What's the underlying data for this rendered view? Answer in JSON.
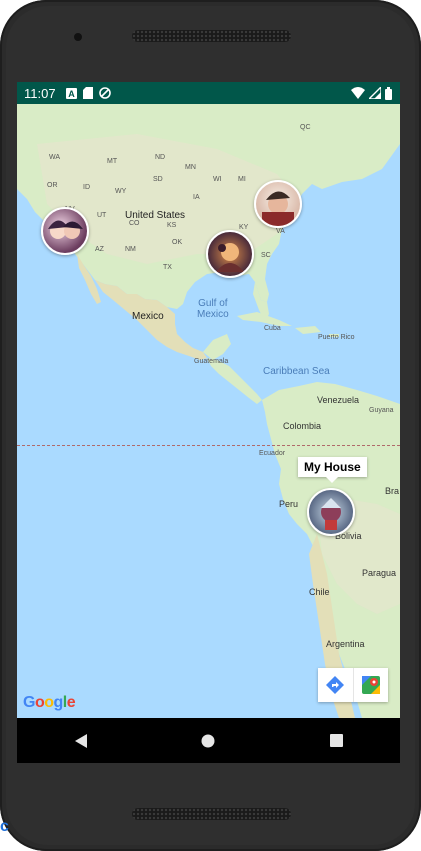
{
  "status_bar": {
    "time": "11:07",
    "icons": [
      "a-notification-icon",
      "sd-card-icon",
      "sync-icon"
    ],
    "right_icons": [
      "wifi-icon",
      "signal-icon",
      "battery-icon"
    ],
    "background": "#01574a"
  },
  "map": {
    "labels": {
      "wa": "WA",
      "mt": "MT",
      "nd": "ND",
      "mn": "MN",
      "or": "OR",
      "id": "ID",
      "sd": "SD",
      "wy": "WY",
      "wi": "WI",
      "mi": "MI",
      "nv": "NV",
      "ut": "UT",
      "co": "CO",
      "ks": "KS",
      "ia": "IA",
      "ca": "CA",
      "az": "AZ",
      "nm": "NM",
      "ok": "OK",
      "tx": "TX",
      "ky": "KY",
      "tn": "TN",
      "sc": "SC",
      "va": "VA",
      "qc": "QC",
      "united_states": "United States",
      "mexico": "Mexico",
      "gulf": "Gulf of\nMexico",
      "cuba": "Cuba",
      "puerto_rico": "Puerto Rico",
      "guatemala": "Guatemala",
      "caribbean": "Caribbean Sea",
      "venezuela": "Venezuela",
      "guyana": "Guyana",
      "colombia": "Colombia",
      "ecuador": "Ecuador",
      "peru": "Peru",
      "bolivia": "Bolivia",
      "bra": "Bra",
      "paraguay": "Paragua",
      "chile": "Chile",
      "argentina": "Argentina"
    },
    "markers": [
      {
        "id": "west",
        "icon": "avatar-marker"
      },
      {
        "id": "northeast",
        "icon": "avatar-marker"
      },
      {
        "id": "southeast",
        "icon": "avatar-marker"
      },
      {
        "id": "house",
        "icon": "avatar-marker"
      }
    ],
    "info_window": "My House",
    "attribution": "Google",
    "toolbar": {
      "directions": "directions-icon",
      "open_maps": "google-maps-icon"
    }
  },
  "nav": {
    "back": "back-icon",
    "home": "home-icon",
    "recents": "recents-icon"
  }
}
